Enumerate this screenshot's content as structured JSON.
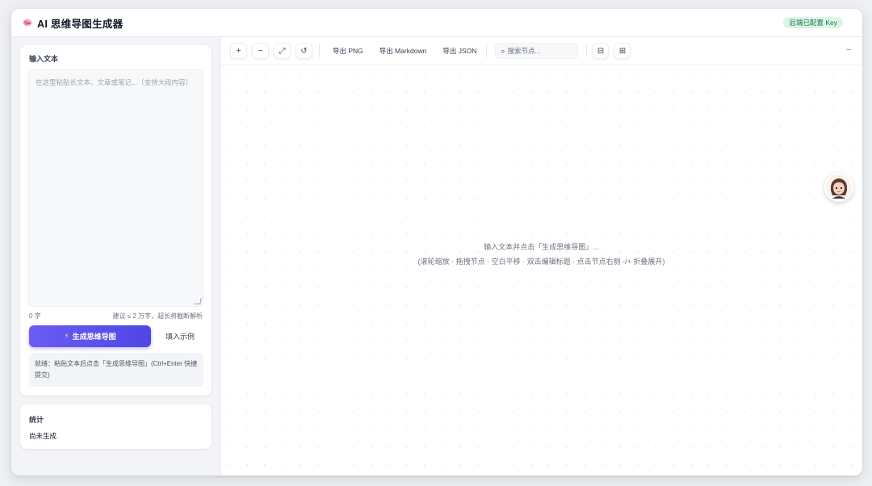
{
  "header": {
    "logo_icon": "brain-icon",
    "title": "AI 思维导图生成器",
    "key_badge": "后端已配置 Key"
  },
  "input_panel": {
    "title": "输入文本",
    "textarea_placeholder": "在这里粘贴长文本、文章或笔记...（支持大段内容）",
    "char_count": "0 字",
    "limit_hint": "建议 ≤ 2 万字，超长将截断解析",
    "generate_button": "生成思维导图",
    "generate_icon": "lightning-icon",
    "example_button": "填入示例",
    "status": "就绪：粘贴文本后点击「生成思维导图」(Ctrl+Enter 快捷提交)"
  },
  "stats_panel": {
    "title": "统计",
    "value": "尚未生成"
  },
  "toolbar": {
    "zoom_in": "+",
    "zoom_out": "−",
    "fit": "⤢",
    "reset": "↺",
    "export_png": "导出 PNG",
    "export_md": "导出 Markdown",
    "export_json": "导出 JSON",
    "search_placeholder": "搜索节点...",
    "collapse_all": "⊟",
    "expand_all": "⊞",
    "minimize": "–"
  },
  "canvas": {
    "empty_line1": "输入文本并点击「生成思维导图」...",
    "empty_line2": "(滚轮缩放 · 拖拽节点 · 空白平移 · 双击编辑标题 · 点击节点右侧 -/+ 折叠展开)"
  },
  "colors": {
    "accent": "#4f46e5",
    "badge_bg": "#dcf5e6",
    "badge_text": "#16794a"
  }
}
